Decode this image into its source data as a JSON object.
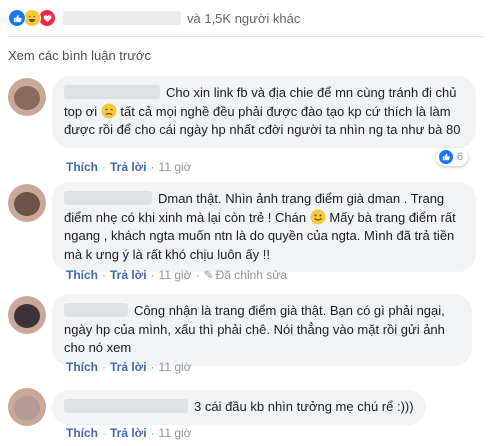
{
  "reactions": {
    "others_text": "và 1,5K người khác",
    "icons": [
      "like-icon",
      "haha-icon",
      "love-icon"
    ]
  },
  "prev_comments_link": "Xem các bình luận trước",
  "comments": [
    {
      "text": "Cho xin link fb và địa chie để mn cùng tránh đi chủ top ơi",
      "emoji": "disappointed-face-icon",
      "text2": "tất cả mọi nghề đều phải được đào tạo kp cứ thích là làm được rồi để cho cái ngày hp nhất cđời người ta nhìn ng ta như bà 80",
      "like_label": "Thích",
      "reply_label": "Trả lời",
      "time": "11 giờ",
      "like_count": "6"
    },
    {
      "text": "Dman thật. Nhìn ảnh trang điểm già dman . Trang điểm nhẹ có khi xinh mà lại còn trẻ ! Chán",
      "emoji": "smile-face-icon",
      "text2": "Mấy bà trang điểm rất ngang , khách ngta muốn ntn là do quyền của ngta. Mình đã trả tiền mà k ưng ý là rất khó chịu luôn ấy !!",
      "like_label": "Thích",
      "reply_label": "Trả lời",
      "time": "11 giờ",
      "edited": "Đã chỉnh sửa"
    },
    {
      "text": "Công nhận là trang điểm già thật. Bạn có gì phải ngại, ngày hp của mình, xấu thì phải chê. Nói thẳng vào mặt rồi gửi ảnh cho nó xem",
      "like_label": "Thích",
      "reply_label": "Trả lời",
      "time": "11 giờ"
    },
    {
      "text": "3 cái đầu kb nhìn tưởng mẹ chú rể :)))",
      "like_label": "Thích",
      "reply_label": "Trả lời",
      "time": "11 giờ"
    }
  ],
  "colors": {
    "link": "#4267b2",
    "bubble": "#f2f3f5",
    "like_blue": "#1877f2"
  }
}
